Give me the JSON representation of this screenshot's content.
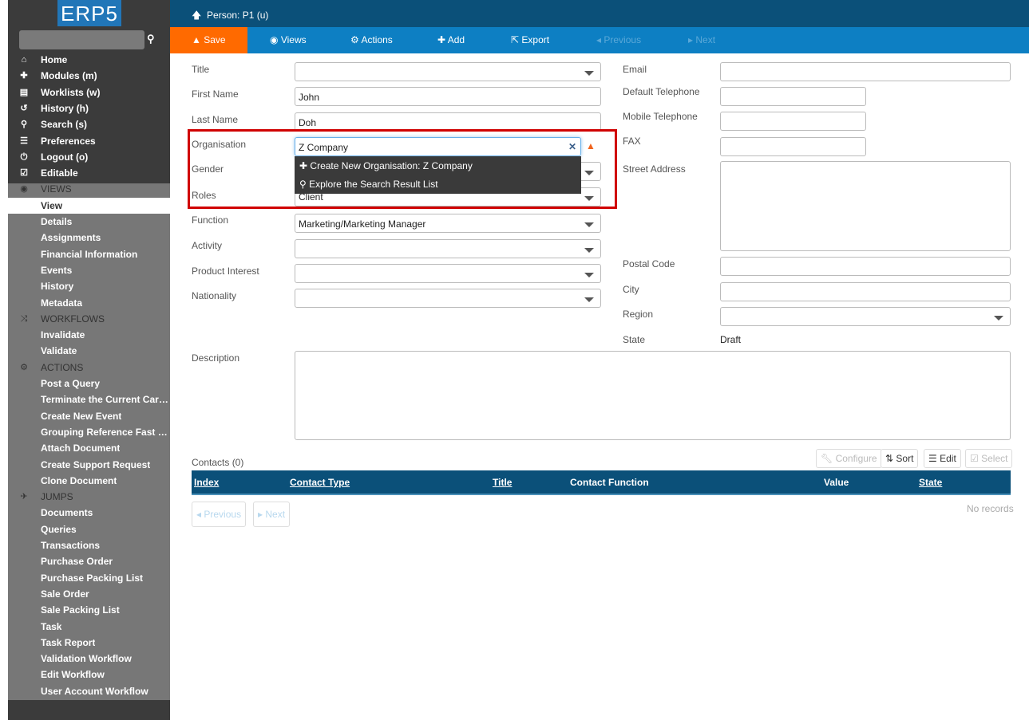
{
  "sidebar": {
    "logo": "ERP5",
    "search_placeholder": "",
    "top": [
      {
        "icon": "home-icon",
        "g": "⌂",
        "label": "Home"
      },
      {
        "icon": "puzzle-icon",
        "g": "✚",
        "label": "Modules (m)"
      },
      {
        "icon": "list-icon",
        "g": "▤",
        "label": "Worklists (w)"
      },
      {
        "icon": "history-icon",
        "g": "↺",
        "label": "History (h)"
      },
      {
        "icon": "search-icon",
        "g": "⚲",
        "label": "Search (s)"
      },
      {
        "icon": "sliders-icon",
        "g": "☰",
        "label": "Preferences"
      },
      {
        "icon": "power-icon",
        "g": "⏻",
        "label": "Logout (o)"
      },
      {
        "icon": "checkbox-icon",
        "g": "☑",
        "label": "Editable"
      }
    ],
    "views_header": "VIEWS",
    "views": [
      "View",
      "Details",
      "Assignments",
      "Financial Information",
      "Events",
      "History",
      "Metadata"
    ],
    "workflows_header": "WORKFLOWS",
    "workflows": [
      "Invalidate",
      "Validate"
    ],
    "actions_header": "ACTIONS",
    "actions": [
      "Post a Query",
      "Terminate the Current Career...",
      "Create New Event",
      "Grouping Reference Fast Input",
      "Attach Document",
      "Create Support Request",
      "Clone Document"
    ],
    "jumps_header": "JUMPS",
    "jumps": [
      "Documents",
      "Queries",
      "Transactions",
      "Purchase Order",
      "Purchase Packing List",
      "Sale Order",
      "Sale Packing List",
      "Task",
      "Task Report",
      "Validation Workflow",
      "Edit Workflow",
      "User Account Workflow"
    ]
  },
  "header": {
    "title": "Person: P1 (u)"
  },
  "toolbar": {
    "save": "Save",
    "views": "Views",
    "actions": "Actions",
    "add": "Add",
    "export": "Export",
    "previous": "Previous",
    "next": "Next"
  },
  "form": {
    "title_label": "Title",
    "title_value": "",
    "first_name_label": "First Name",
    "first_name": "John",
    "last_name_label": "Last Name",
    "last_name": "Doh",
    "organisation_label": "Organisation",
    "organisation": "Z Company",
    "gender_label": "Gender",
    "gender": "",
    "roles_label": "Roles",
    "roles": "Client",
    "function_label": "Function",
    "function": "Marketing/Marketing Manager",
    "activity_label": "Activity",
    "product_interest_label": "Product Interest",
    "nationality_label": "Nationality",
    "email_label": "Email",
    "default_telephone_label": "Default Telephone",
    "mobile_telephone_label": "Mobile Telephone",
    "fax_label": "FAX",
    "street_address_label": "Street Address",
    "postal_code_label": "Postal Code",
    "city_label": "City",
    "region_label": "Region",
    "state_label": "State",
    "state": "Draft",
    "description_label": "Description"
  },
  "autocomplete": {
    "create": "Create New Organisation: Z Company",
    "explore": "Explore the Search Result List"
  },
  "contacts": {
    "title": "Contacts (0)",
    "configure": "Configure",
    "sort": "Sort",
    "edit": "Edit",
    "select": "Select",
    "columns": [
      "Index",
      "Contact Type",
      "Title",
      "Contact Function",
      "Value",
      "State"
    ],
    "previous": "Previous",
    "next": "Next",
    "empty": "No records"
  },
  "colors": {
    "accent": "#0d7fc3",
    "header": "#0b5079",
    "save": "#ff6a00",
    "highlight": "#d00000"
  }
}
